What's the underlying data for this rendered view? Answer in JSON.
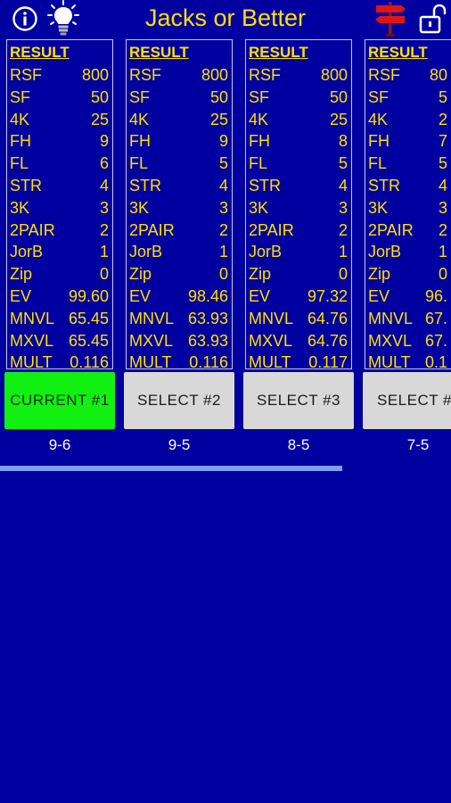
{
  "app": {
    "title": "Jacks or Better"
  },
  "icons": {
    "info": "info-icon",
    "hint": "lightbulb-icon",
    "navigate": "signpost-icon",
    "lock": "lock-icon"
  },
  "colors": {
    "background": "#0000a0",
    "text": "#ffe000",
    "current": "#12f012",
    "button": "#d8d8d8"
  },
  "columns": [
    {
      "header": "RESULT",
      "rows": [
        {
          "label": "RSF",
          "value": "800"
        },
        {
          "label": "SF",
          "value": "50"
        },
        {
          "label": "4K",
          "value": "25"
        },
        {
          "label": "FH",
          "value": "9"
        },
        {
          "label": "FL",
          "value": "6"
        },
        {
          "label": "STR",
          "value": "4"
        },
        {
          "label": "3K",
          "value": "3"
        },
        {
          "label": "2PAIR",
          "value": "2"
        },
        {
          "label": "JorB",
          "value": "1"
        },
        {
          "label": "Zip",
          "value": "0"
        },
        {
          "label": "EV",
          "value": "99.60"
        },
        {
          "label": "MNVL",
          "value": "65.45"
        },
        {
          "label": "MXVL",
          "value": "65.45"
        },
        {
          "label": "MULT",
          "value": "0.116"
        }
      ],
      "button": "CURRENT  #1",
      "current": true,
      "label": "9-6"
    },
    {
      "header": "RESULT",
      "rows": [
        {
          "label": "RSF",
          "value": "800"
        },
        {
          "label": "SF",
          "value": "50"
        },
        {
          "label": "4K",
          "value": "25"
        },
        {
          "label": "FH",
          "value": "9"
        },
        {
          "label": "FL",
          "value": "5"
        },
        {
          "label": "STR",
          "value": "4"
        },
        {
          "label": "3K",
          "value": "3"
        },
        {
          "label": "2PAIR",
          "value": "2"
        },
        {
          "label": "JorB",
          "value": "1"
        },
        {
          "label": "Zip",
          "value": "0"
        },
        {
          "label": "EV",
          "value": "98.46"
        },
        {
          "label": "MNVL",
          "value": "63.93"
        },
        {
          "label": "MXVL",
          "value": "63.93"
        },
        {
          "label": "MULT",
          "value": "0.116"
        }
      ],
      "button": "SELECT  #2",
      "current": false,
      "label": "9-5"
    },
    {
      "header": "RESULT",
      "rows": [
        {
          "label": "RSF",
          "value": "800"
        },
        {
          "label": "SF",
          "value": "50"
        },
        {
          "label": "4K",
          "value": "25"
        },
        {
          "label": "FH",
          "value": "8"
        },
        {
          "label": "FL",
          "value": "5"
        },
        {
          "label": "STR",
          "value": "4"
        },
        {
          "label": "3K",
          "value": "3"
        },
        {
          "label": "2PAIR",
          "value": "2"
        },
        {
          "label": "JorB",
          "value": "1"
        },
        {
          "label": "Zip",
          "value": "0"
        },
        {
          "label": "EV",
          "value": "97.32"
        },
        {
          "label": "MNVL",
          "value": "64.76"
        },
        {
          "label": "MXVL",
          "value": "64.76"
        },
        {
          "label": "MULT",
          "value": "0.117"
        }
      ],
      "button": "SELECT  #3",
      "current": false,
      "label": "8-5"
    },
    {
      "header": "RESULT",
      "rows": [
        {
          "label": "RSF",
          "value": "80"
        },
        {
          "label": "SF",
          "value": "5"
        },
        {
          "label": "4K",
          "value": "2"
        },
        {
          "label": "FH",
          "value": "7"
        },
        {
          "label": "FL",
          "value": "5"
        },
        {
          "label": "STR",
          "value": "4"
        },
        {
          "label": "3K",
          "value": "3"
        },
        {
          "label": "2PAIR",
          "value": "2"
        },
        {
          "label": "JorB",
          "value": "1"
        },
        {
          "label": "Zip",
          "value": "0"
        },
        {
          "label": "EV",
          "value": "96."
        },
        {
          "label": "MNVL",
          "value": "67."
        },
        {
          "label": "MXVL",
          "value": "67."
        },
        {
          "label": "MULT",
          "value": "0.1"
        }
      ],
      "button": "SELECT  #",
      "current": false,
      "label": "7-5"
    }
  ]
}
